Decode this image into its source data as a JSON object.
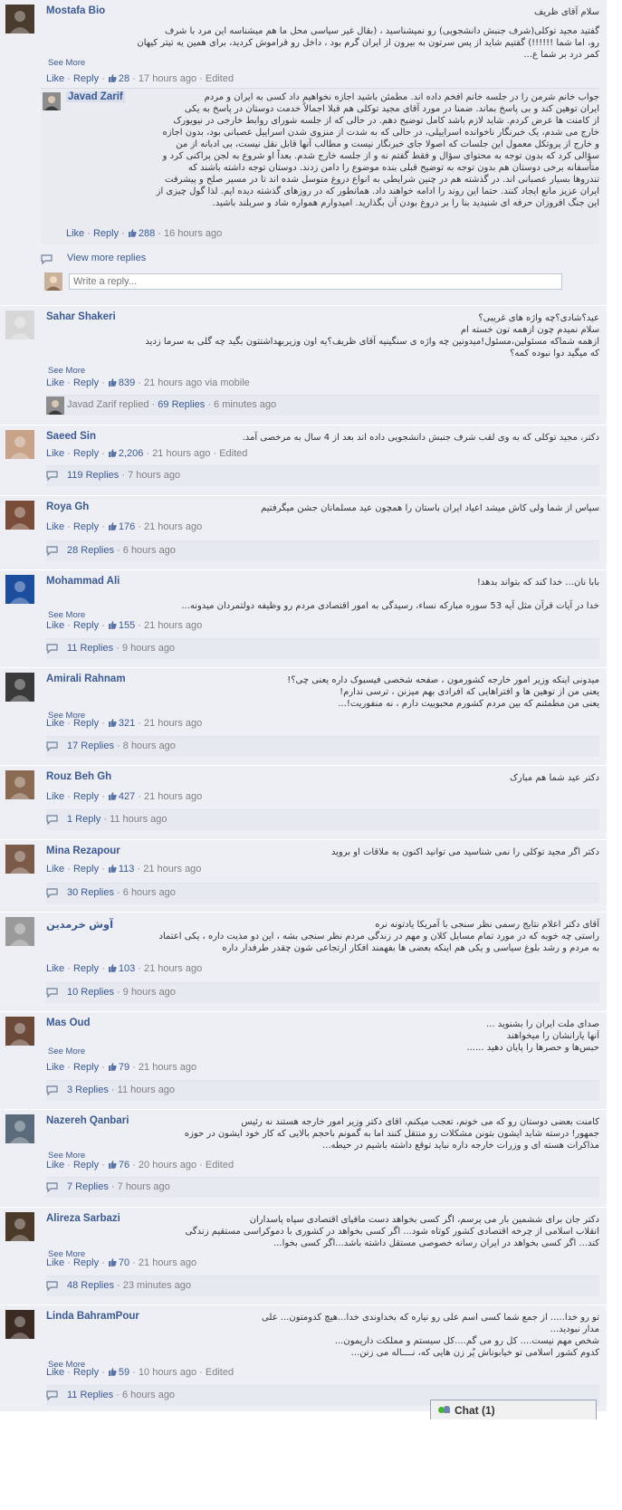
{
  "ui": {
    "like": "Like",
    "reply": "Reply",
    "see_more": "See More",
    "view_more_replies": "View more replies",
    "write_reply_placeholder": "Write a reply...",
    "sep": " · ",
    "edited": "Edited",
    "via_mobile": "via mobile",
    "colors": {
      "link": "#3b5998",
      "comment_bg": "#edeff4",
      "meta": "#808080"
    }
  },
  "comments": [
    {
      "name": "Mostafa Bio",
      "text_lines": [
        "سلام آقای ظریف",
        "گفتید مجید توکلی(شرف جنبش دانشجویی) رو نمیشناسید ، (بقال غیر سیاسی محل ما هم میشناسه این مرد با شرف",
        "رو، اما شما !!!!!!) گفتیم شاید از پس سرتون به بیرون از ایران گرم بود ، داخل رو فراموش کردید، برای همین یه تیتر کیهان",
        "کمر درد بر شما ع..."
      ],
      "likes": "28",
      "time": "17 hours ago",
      "edited": true,
      "nested_reply": {
        "name": "Javad Zarif",
        "text_lines": [
          "جواب خانم شرمن را در جلسه خانم افخم داده اند. مطمئن باشید اجازه نخواهیم داد کسی به ایران و مردم",
          "ایران توهین کند و بی پاسخ بماند. ضمنا در مورد آقای مجید توکلی هم قبلا اجمالاً خدمت دوستان در پاسخ به یکی",
          "از کامنت ها عرض کردم. شاید لازم باشد کامل توضیح دهم. در حالی که از جلسه شورای روابط خارجی در نیویورک",
          "خارج می شدم، یک خبرنگار ناخوانده اسراییلی، در حالی که به شدت از منزوی شدن اسراییل عصبانی بود، بدون اجازه",
          "و خارج از پروتکل معمول این جلسات که اصولا جای خبرنگار نیست و مطالب آنها قابل نقل نیست، بی ادبانه از من",
          "سؤالی کرد که بدون توجه به محتوای سؤال و فقط گفتم نه و از جلسه خارج شدم. بعداً او شروع به لجن پراکنی کرد و",
          "متأسفانه برخی دوستان هم بدون توجه به توضیح قبلی بنده موضوع را دامن زدند. دوستان توجه داشته باشند که",
          "تندروها بسیار عصبانی اند. در گذشته هم در چنین شرایطی به انواع دروغ متوسل شده اند تا در مسیر صلح و پیشرفت",
          "ایران عزیز مانع ایجاد کنند. حتما این روند را ادامه خواهند داد. همانطور که در روزهای گذشته دیده ایم. لذا گول چیزی از",
          "این جنگ افروزان حرفه ای شنیدید بنا را بر دروغ بودن آن بگذارید. امیدوارم همواره شاد و سربلند باشید."
        ],
        "likes": "288",
        "time": "16 hours ago"
      }
    },
    {
      "name": "Sahar Shakeri",
      "text_lines": [
        "عید؟شادی؟چه واژه های غریبی؟",
        "سلام نمیدم چون ازهمه تون خسته ام",
        "ازهمه شماکه مسئولین،مسئول!میدونین چه واژه ی سنگینیه آقای ظریف؟یه اون وزیربهداشتتون بگید چه گلی به سرما زدید",
        "که میگید دوا نبوده کمه؟"
      ],
      "likes": "839",
      "time": "21 hours ago",
      "via_mobile": true,
      "replied_by": "Javad Zarif replied",
      "replies": "69 Replies",
      "replies_time": "6 minutes ago"
    },
    {
      "name": "Saeed Sin",
      "text_lines": [
        "دکتر، مجید توکلی که به وی لقب شرف جنبش دانشجویی داده اند بعد از 4 سال به مرخصی آمد."
      ],
      "likes": "2,206",
      "time": "21 hours ago",
      "edited": true,
      "replies": "119 Replies",
      "replies_time": "7 hours ago"
    },
    {
      "name": "Roya Gh",
      "text_lines": [
        "سپاس از شما ولی کاش میشد اعیاد ایران باستان را همچون عید مسلمانان جشن میگرفتیم"
      ],
      "likes": "176",
      "time": "21 hours ago",
      "replies": "28 Replies",
      "replies_time": "6 hours ago"
    },
    {
      "name": "Mohammad Ali",
      "text_lines": [
        "بابا نان... خدا کند که بتواند بدهد!",
        "",
        "خدا در آیات قرآن مثل آیه 53 سوره مبارکه نساء، رسیدگی به امور اقتصادی مردم رو وظیفه دولتمردان میدونه..."
      ],
      "likes": "155",
      "time": "21 hours ago",
      "replies": "11 Replies",
      "replies_time": "9 hours ago"
    },
    {
      "name": "Amirali Rahnam",
      "text_lines": [
        "میدونی اینکه وزیر امور خارجه کشورمون ، صفحه شخصی فیسبوک داره یعنی چی؟!",
        "یعنی من از توهین ها و افتراهایی که افرادی بهم میزنن ، ترسی ندارم!",
        "یعنی من مطمئنم که بین مردم کشورم محبوبیت دارم ، نه منفوریت!..."
      ],
      "likes": "321",
      "time": "21 hours ago",
      "replies": "17 Replies",
      "replies_time": "8 hours ago"
    },
    {
      "name": "Rouz Beh Gh",
      "text_lines": [
        "دکتر عید شما هم مبارک"
      ],
      "likes": "427",
      "time": "21 hours ago",
      "replies": "1 Reply",
      "replies_time": "11 hours ago"
    },
    {
      "name": "Mina Rezapour",
      "text_lines": [
        "دکتر اگر مجید توکلی را نمی شناسید می توانید اکنون به ملاقات او بروید"
      ],
      "likes": "113",
      "time": "21 hours ago",
      "replies": "30 Replies",
      "replies_time": "6 hours ago"
    },
    {
      "name": "آوش خرمدین",
      "text_lines": [
        "آقای دکتر اعلام نتایج رسمی نظر سنجی با آمریکا یادتونه نره",
        "راستی چه خوبه که در مورد تمام مسایل کلان و مهم در زندگی مردم نظر سنجی بشه ، این دو مذیت داره ، یکی اعتماد",
        "به مردم و رشد بلوغ سیاسی و یکی هم اینکه بعضی ها بفهمند افکار ارتجاعی شون چقدر طرفدار داره"
      ],
      "likes": "103",
      "time": "21 hours ago",
      "replies": "10 Replies",
      "replies_time": "9 hours ago"
    },
    {
      "name": "Mas Oud",
      "text_lines": [
        "صدای ملت ایران را بشنوید ...",
        "آنها یارانشان را میخواهند",
        "حبس‌ها و حصرها را پایان دهید ......"
      ],
      "likes": "79",
      "time": "21 hours ago",
      "replies": "3 Replies",
      "replies_time": "11 hours ago"
    },
    {
      "name": "Nazereh Qanbari",
      "text_lines": [
        "کامنت بعضی دوستان رو که می خونم، تعجب میکنم، اقای دکتر وزیر امور خارجه هستند نه رئیس",
        "جمهور! درسته شاید ایشون بتونن مشکلات رو منتقل کنند اما به گمونم باحجم بالایی که کار خود ایشون در حوزه",
        "مذاکرات هسته ای و وزرات خارجه داره نباید توقع داشته باشیم در حیطه..."
      ],
      "likes": "76",
      "time": "20 hours ago",
      "edited": true,
      "replies": "7 Replies",
      "replies_time": "7 hours ago"
    },
    {
      "name": "Alireza Sarbazi",
      "text_lines": [
        "دکتر جان برای ششمین بار می پرسم، اگر کسی بخواهد دست مافیای اقتصادی سپاه پاسداران",
        "انقلاب اسلامی از چرخه اقتصادی کشور کوتاه شود... اگر کسی بخواهد در کشوری با دموکراسی مستقیم زندگی",
        "کند... اگر کسی بخواهد در ایران رسانه خصوصی مستقل داشته باشد...اگر کسی بخوا..."
      ],
      "likes": "70",
      "time": "21 hours ago",
      "replies": "48 Replies",
      "replies_time": "23 minutes ago"
    },
    {
      "name": "Linda BahramPour",
      "text_lines": [
        "تو رو خدا..... از جمع شما کسی اسم علی رو نیاره که بخداوندی خدا...هیچ کدومتون... علی",
        "مدار نبودید...",
        "شخص مهم نیست.... کل رو می گم....کل سیستم و مملکت داریمون...",
        "کدوم کشور اسلامی تو خیابوناش پُر زن هایی که، نــــاله می زنن..."
      ],
      "likes": "59",
      "time": "10 hours ago",
      "edited": true,
      "replies": "11 Replies",
      "replies_time": "6 hours ago"
    }
  ],
  "chat": {
    "label": "Chat (1)"
  }
}
